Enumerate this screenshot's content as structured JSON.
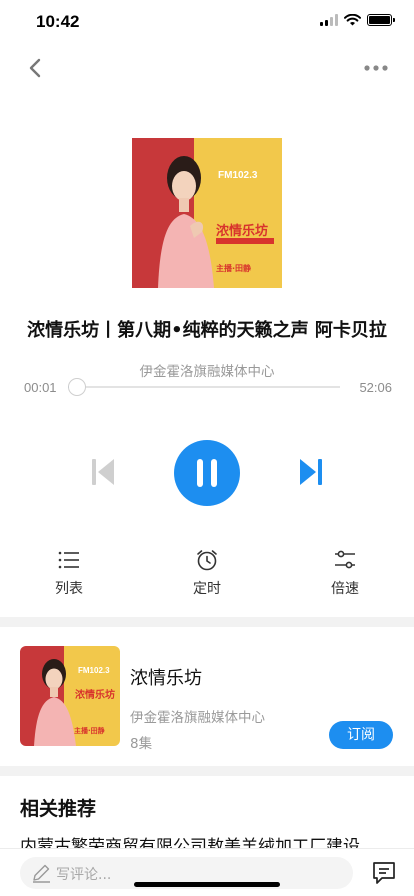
{
  "status_bar": {
    "time": "10:42"
  },
  "player": {
    "cover_freq": "FM102.3",
    "cover_name": "浓情乐坊",
    "cover_host": "主播·田静",
    "title": "浓情乐坊丨第八期•纯粹的天籁之声 阿卡贝拉",
    "source": "伊金霍洛旗融媒体中心",
    "time_current": "00:01",
    "time_total": "52:06",
    "progress_fraction": 0.0003,
    "actions": [
      {
        "label": "列表",
        "icon": "list-icon"
      },
      {
        "label": "定时",
        "icon": "alarm-clock-icon"
      },
      {
        "label": "倍速",
        "icon": "speed-sliders-icon"
      }
    ]
  },
  "album": {
    "cover_freq": "FM102.3",
    "cover_name": "浓情乐坊",
    "cover_host": "主播·田静",
    "title": "浓情乐坊",
    "source": "伊金霍洛旗融媒体中心",
    "count": "8集",
    "subscribe_label": "订阅"
  },
  "related": {
    "title": "相关推荐",
    "items": [
      "内蒙古繁荣商贸有限公司敖美羊绒加工厂建设"
    ]
  },
  "comment": {
    "placeholder": "写评论..."
  },
  "colors": {
    "accent": "#1d8ef0",
    "cover_red": "#c7383a",
    "cover_yellow": "#f2c84b"
  }
}
